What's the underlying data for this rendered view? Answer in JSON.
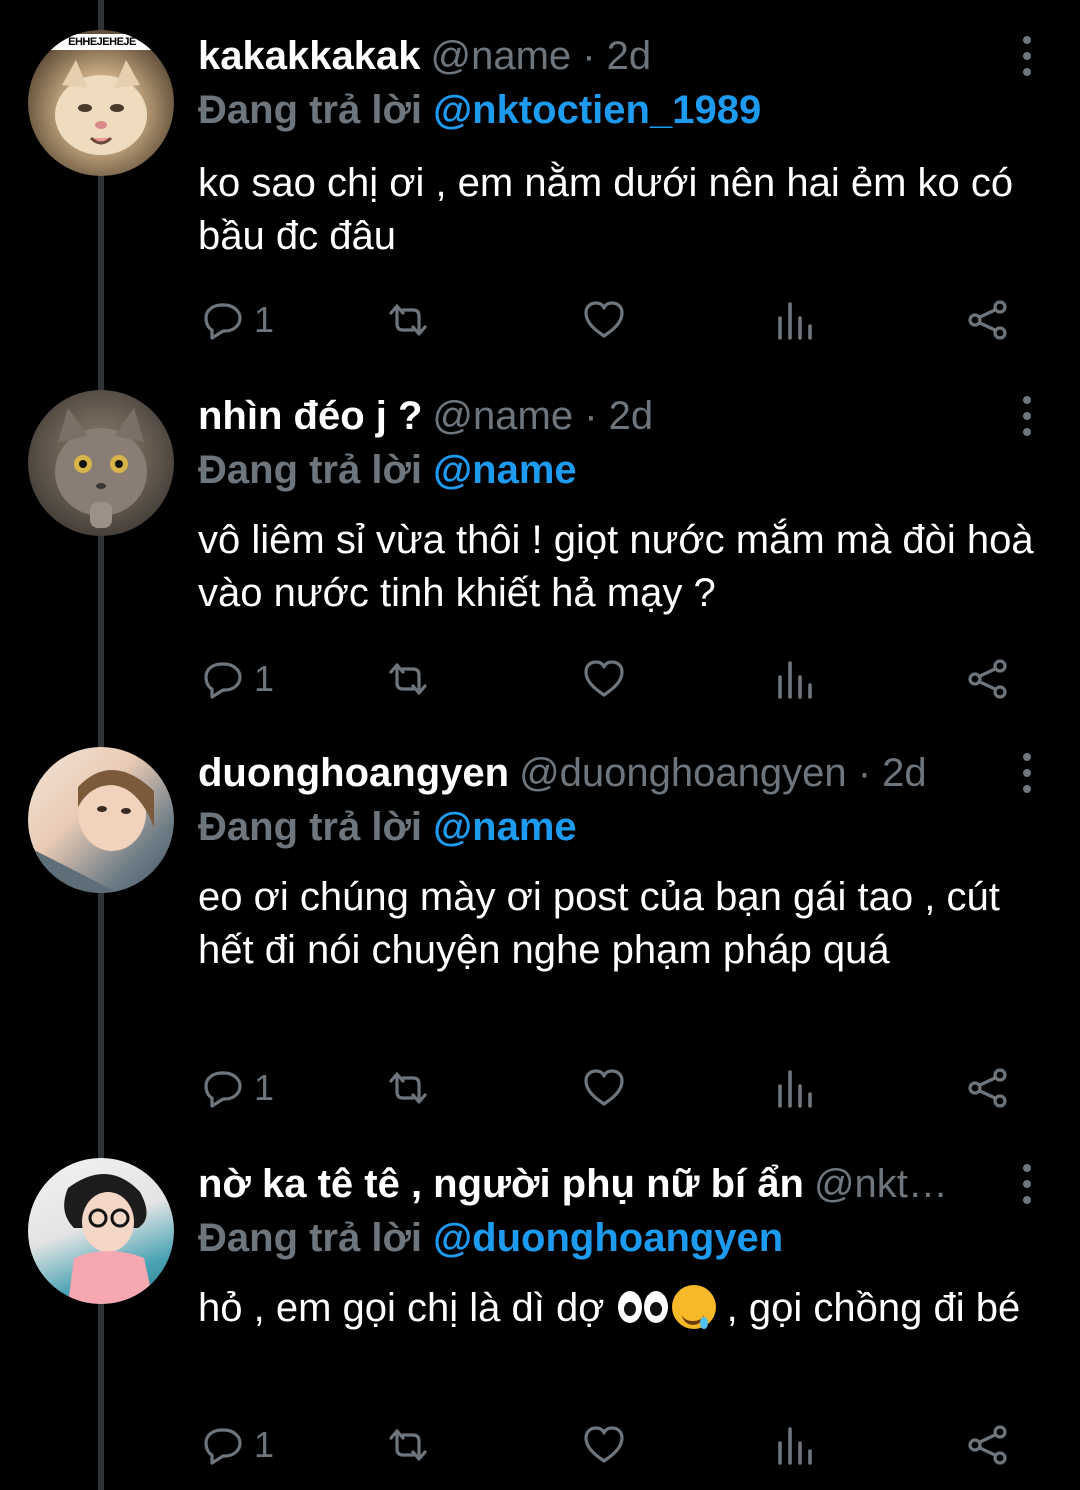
{
  "tweets": [
    {
      "name": "kakakkakak",
      "handle": "@name · 2d",
      "replying_prefix": "Đang trả lời",
      "replying_to": "@nktoctien_1989",
      "text": "ko sao chị ơi , em nằm dưới nên hai ẻm ko có bầu đc đâu",
      "avatar_badge": "EHHEJEHEJE",
      "reply_count": "1"
    },
    {
      "name": "nhìn đéo j ?",
      "handle": "@name · 2d",
      "replying_prefix": "Đang trả lời",
      "replying_to": "@name",
      "text": "vô liêm sỉ vừa thôi ! giọt nước mắm mà đòi hoà vào nước tinh khiết hả mạy ?",
      "reply_count": "1"
    },
    {
      "name": "duonghoangyen",
      "handle": "@duonghoangyen · 2d",
      "replying_prefix": "Đang trả lời",
      "replying_to": "@name",
      "text": "eo ơi chúng mày ơi post của bạn gái tao , cút hết đi nói chuyện nghe phạm pháp quá",
      "reply_count": "1"
    },
    {
      "name": "nờ ka tê tê , người phụ nữ bí ẩn",
      "handle": "@nkt…",
      "replying_prefix": "Đang trả lời",
      "replying_to": "@duonghoangyen",
      "text_before": "hỏ , em gọi chị là dì dợ ",
      "text_after": " , gọi chồng đi bé",
      "reply_count": "1"
    }
  ],
  "colors": {
    "background": "#000000",
    "muted": "#6e767d",
    "accent": "#1d9bf0",
    "thread_line": "#2f3336"
  },
  "icons": [
    "reply-icon",
    "retweet-icon",
    "like-icon",
    "analytics-icon",
    "share-icon",
    "more-icon"
  ]
}
